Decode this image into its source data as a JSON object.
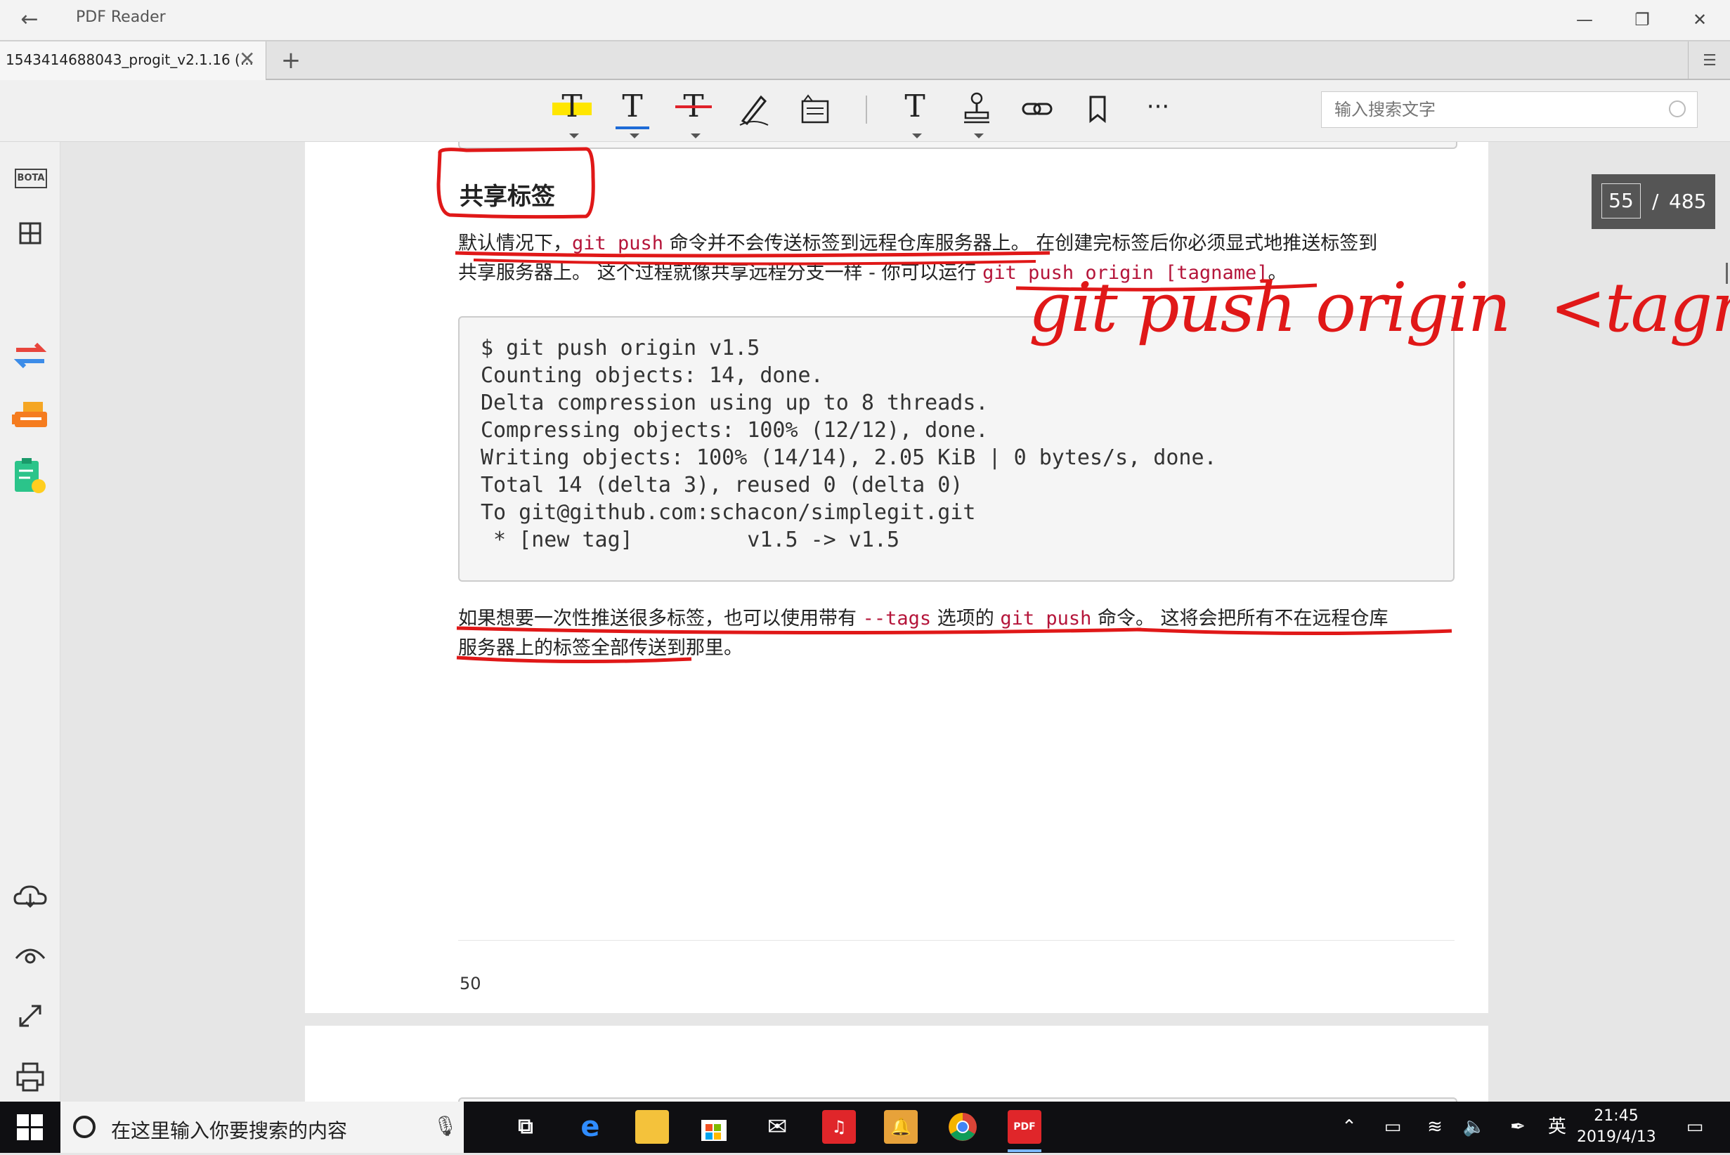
{
  "window": {
    "app_title": "PDF Reader",
    "back_icon": "back-arrow-icon",
    "minimize": "—",
    "restore": "❐",
    "close": "✕"
  },
  "tabs": {
    "active_label": "1543414688043_progit_v2.1.16 (...",
    "close": "✕",
    "add": "+",
    "menu": "☰"
  },
  "toolbar": {
    "tools": [
      {
        "name": "highlight-icon",
        "glyph": "T",
        "accent": "#ffe600"
      },
      {
        "name": "underline-icon",
        "glyph": "T",
        "accent": "#1e6bd6"
      },
      {
        "name": "strikethrough-icon",
        "glyph": "T",
        "accent": "#e0222a"
      },
      {
        "name": "pen-icon",
        "glyph": "✎"
      },
      {
        "name": "note-icon",
        "glyph": "▤"
      },
      {
        "name": "text-icon",
        "glyph": "T"
      },
      {
        "name": "stamp-icon",
        "glyph": "⚲"
      },
      {
        "name": "link-icon",
        "glyph": "⚭"
      },
      {
        "name": "bookmark-icon",
        "glyph": "🔖"
      },
      {
        "name": "more-icon",
        "glyph": "···"
      }
    ],
    "search_placeholder": "输入搜索文字"
  },
  "sidebar": {
    "bota_label": "BOTA",
    "items": [
      "bota-icon",
      "thumbnails-icon",
      "convert-icon",
      "fax-icon",
      "tasks-icon",
      "cloud-icon",
      "eye-icon",
      "fullscreen-icon",
      "print-icon"
    ]
  },
  "page_indicator": {
    "current": "55",
    "separator": "/",
    "total": "485"
  },
  "document": {
    "heading": "共享标签",
    "para1": {
      "a": "默认情况下，",
      "code1": "git push",
      "b": " 命令并不会传送标签到远程仓库服务器上。 在创建完标签后你必须显式地推送标签到",
      "c": "共享服务器上。 这个过程就像共享远程分支一样 - 你可以运行 ",
      "code2": "git push origin [tagname]",
      "d": "。"
    },
    "code_lines": [
      "$ git push origin v1.5",
      "Counting objects: 14, done.",
      "Delta compression using up to 8 threads.",
      "Compressing objects: 100% (12/12), done.",
      "Writing objects: 100% (14/14), 2.05 KiB | 0 bytes/s, done.",
      "Total 14 (delta 3), reused 0 (delta 0)",
      "To git@github.com:schacon/simplegit.git",
      " * [new tag]         v1.5 -> v1.5"
    ],
    "para2": {
      "a": "如果想要一次性推送很多标签，也可以使用带有 ",
      "code1": "--tags",
      "b": " 选项的 ",
      "code2": "git push",
      "c": " 命令。 这将会把所有不在远程仓库",
      "d": "服务器上的标签全部传送到那里。"
    },
    "page_number": "50"
  },
  "annotation": {
    "handwriting": "git push origin  <tagname>",
    "ink_color": "#e01818"
  },
  "taskbar": {
    "search_text": "在这里输入你要搜索的内容",
    "ime": "英",
    "time": "21:45",
    "date": "2019/4/13"
  }
}
